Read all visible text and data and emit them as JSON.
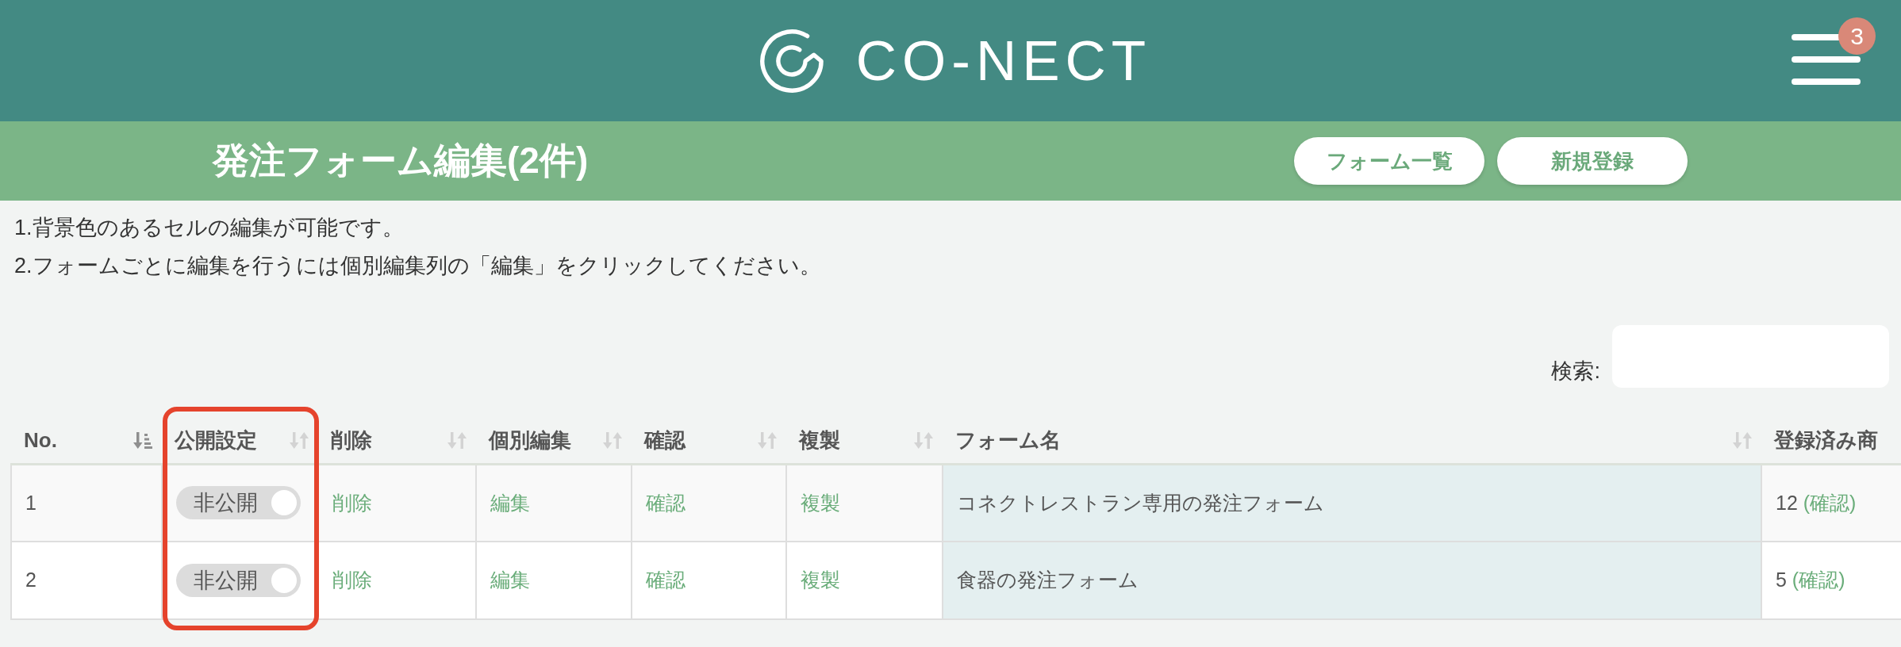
{
  "header": {
    "logo": "CO-NECT",
    "menu_badge": "3"
  },
  "title_bar": {
    "title": "発注フォーム編集(2件)",
    "buttons": [
      "フォーム一覧",
      "新規登録"
    ]
  },
  "notes": [
    "1.背景色のあるセルの編集が可能です。",
    "2.フォームごとに編集を行うには個別編集列の「編集」をクリックしてください。"
  ],
  "search": {
    "label": "検索:"
  },
  "table": {
    "columns": [
      {
        "label": "No.",
        "sorted": true,
        "highlighted": false,
        "editable": false
      },
      {
        "label": "公開設定",
        "sorted": false,
        "highlighted": true,
        "editable": false
      },
      {
        "label": "削除",
        "sorted": false,
        "highlighted": false,
        "editable": false
      },
      {
        "label": "個別編集",
        "sorted": false,
        "highlighted": false,
        "editable": false
      },
      {
        "label": "確認",
        "sorted": false,
        "highlighted": false,
        "editable": false
      },
      {
        "label": "複製",
        "sorted": false,
        "highlighted": false,
        "editable": false
      },
      {
        "label": "フォーム名",
        "sorted": false,
        "highlighted": false,
        "editable": true
      },
      {
        "label": "登録済み商",
        "highlighted": false,
        "editable": false
      }
    ],
    "rows": [
      {
        "cells": [
          {
            "kind": "text",
            "text": "1"
          },
          {
            "kind": "toggle",
            "label": "非公開",
            "on": false
          },
          {
            "kind": "link",
            "text": "削除"
          },
          {
            "kind": "link",
            "text": "編集"
          },
          {
            "kind": "link",
            "text": "確認"
          },
          {
            "kind": "link",
            "text": "複製"
          },
          {
            "kind": "text",
            "text": "コネクトレストラン専用の発注フォーム"
          },
          {
            "kind": "count",
            "text": "12",
            "link": "(確認)"
          }
        ]
      },
      {
        "cells": [
          {
            "kind": "text",
            "text": "2"
          },
          {
            "kind": "toggle",
            "label": "非公開",
            "on": false
          },
          {
            "kind": "link",
            "text": "削除"
          },
          {
            "kind": "link",
            "text": "編集"
          },
          {
            "kind": "link",
            "text": "確認"
          },
          {
            "kind": "link",
            "text": "複製"
          },
          {
            "kind": "text",
            "text": "食器の発注フォーム"
          },
          {
            "kind": "count",
            "text": "5",
            "link": "(確認)"
          }
        ]
      }
    ]
  }
}
